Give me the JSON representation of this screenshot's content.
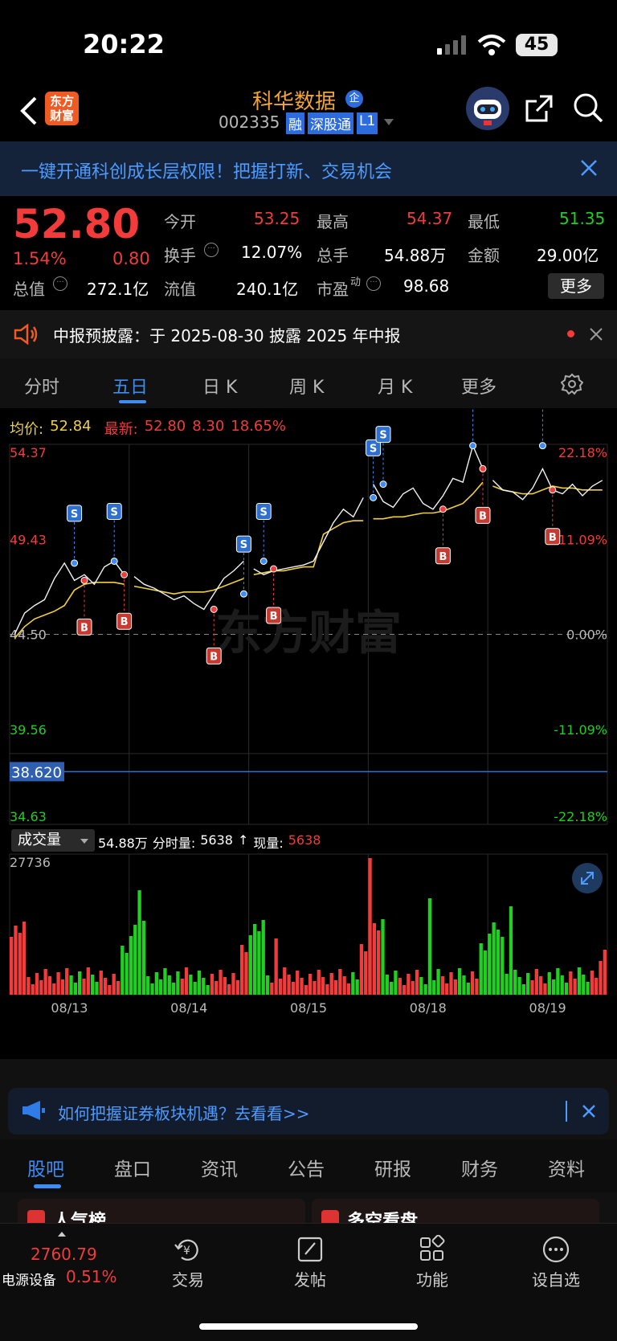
{
  "status_bar": {
    "time": "20:22",
    "battery": "45"
  },
  "nav": {
    "logo_line1": "东方",
    "logo_line2": "财富",
    "stock_name": "科华数据",
    "corp_badge": "企",
    "code": "002335",
    "tags": [
      "融",
      "深股通",
      "L1"
    ]
  },
  "banner": {
    "text": "一键开通科创成长层权限！把握打新、交易机会"
  },
  "quote": {
    "price": "52.80",
    "pct": "1.54%",
    "chg": "0.80",
    "open_label": "今开",
    "open": "53.25",
    "high_label": "最高",
    "high": "54.37",
    "low_label": "最低",
    "low": "51.35",
    "turnover_label": "换手",
    "turnover": "12.07%",
    "volume_label": "总手",
    "volume": "54.88万",
    "amount_label": "金额",
    "amount": "29.00亿",
    "mcap_label": "总值",
    "mcap": "272.1亿",
    "float_label": "流值",
    "float": "240.1亿",
    "pe_label": "市盈",
    "pe_sup": "动",
    "pe": "98.68",
    "more": "更多"
  },
  "notice": {
    "text": "中报预披露：于 2025-08-30 披露 2025 年中报"
  },
  "tabs": [
    "分时",
    "五日",
    "日 K",
    "周 K",
    "月 K",
    "更多"
  ],
  "active_tab": "五日",
  "chart_header": {
    "avg_label": "均价:",
    "avg": "52.84",
    "last_label": "最新:",
    "last": "52.80",
    "chg": "8.30",
    "pct": "18.65%"
  },
  "y_left": [
    "54.37",
    "49.43",
    "44.50",
    "39.56",
    "34.63"
  ],
  "y_right": [
    "22.18%",
    "11.09%",
    "0.00%",
    "-11.09%",
    "-22.18%"
  ],
  "crosshair_value": "38.620",
  "watermark": "东方财富",
  "volume_header": {
    "select": "成交量",
    "total": "54.88万",
    "fs_label": "分时量:",
    "fs": "5638",
    "arrow": "↑",
    "now_label": "现量:",
    "now": "5638",
    "max": "27736"
  },
  "chart_data": {
    "type": "line",
    "x_labels": [
      "08/13",
      "08/14",
      "08/15",
      "08/18",
      "08/19"
    ],
    "ylim": [
      34.63,
      54.37
    ],
    "prev_close": 44.5,
    "series": [
      {
        "values": [
          44.5,
          45.6,
          46.0,
          46.3,
          47.4,
          48.2,
          47.3,
          47.6,
          47.1,
          48.0,
          48.3,
          47.6,
          47.5,
          47.1,
          46.9,
          46.6,
          46.3,
          46.5,
          46.1,
          45.8,
          46.6,
          47.4,
          47.8,
          48.3,
          47.9,
          47.6,
          47.8,
          47.9,
          48.0,
          48.1,
          48.3,
          49.3,
          50.3,
          51.0,
          50.6,
          51.6,
          52.3,
          51.4,
          51.1,
          51.8,
          52.1,
          51.3,
          51.0,
          51.7,
          52.6,
          52.4,
          54.3,
          53.1,
          52.5,
          52.0,
          51.9,
          51.5,
          52.1,
          53.1,
          52.0,
          51.8,
          52.3,
          51.7,
          52.2,
          52.5
        ]
      },
      {
        "values": [
          44.3,
          44.9,
          45.3,
          45.5,
          45.7,
          46.0,
          46.8,
          47.1,
          47.2,
          47.2,
          47.2,
          47.1,
          47.0,
          46.9,
          46.8,
          46.7,
          46.6,
          46.7,
          46.7,
          46.7,
          46.8,
          47.0,
          47.2,
          47.4,
          47.6,
          47.7,
          47.8,
          47.8,
          47.9,
          48.0,
          48.0,
          49.7,
          50.0,
          50.3,
          50.4,
          50.4,
          50.5,
          50.5,
          50.6,
          50.6,
          50.7,
          50.8,
          50.8,
          50.9,
          51.1,
          51.3,
          51.8,
          52.4,
          52.2,
          52.0,
          51.9,
          51.8,
          51.8,
          52.0,
          52.2,
          52.1,
          52.1,
          52.0,
          52.0,
          52.0
        ]
      }
    ],
    "volume_max": 27736,
    "signals": [
      {
        "type": "S",
        "i": 6,
        "v": 48.2
      },
      {
        "type": "B",
        "i": 7,
        "v": 47.3
      },
      {
        "type": "S",
        "i": 10,
        "v": 48.3
      },
      {
        "type": "B",
        "i": 11,
        "v": 47.6
      },
      {
        "type": "B",
        "i": 20,
        "v": 45.8
      },
      {
        "type": "S",
        "i": 23,
        "v": 46.6
      },
      {
        "type": "S",
        "i": 25,
        "v": 48.3
      },
      {
        "type": "B",
        "i": 26,
        "v": 47.9
      },
      {
        "type": "S",
        "i": 36,
        "v": 51.6
      },
      {
        "type": "S",
        "i": 37,
        "v": 52.3
      },
      {
        "type": "B",
        "i": 43,
        "v": 51.0
      },
      {
        "type": "S",
        "i": 46,
        "v": 54.3
      },
      {
        "type": "B",
        "i": 47,
        "v": 53.1
      },
      {
        "type": "S",
        "i": 53,
        "v": 54.3
      },
      {
        "type": "B",
        "i": 54,
        "v": 52.0
      }
    ]
  },
  "ad": {
    "text": "如何把握证券板块机遇？去看看>>"
  },
  "subtabs": [
    "股吧",
    "盘口",
    "资讯",
    "公告",
    "研报",
    "财务",
    "资料"
  ],
  "active_subtab": "股吧",
  "cards": [
    "人气榜",
    "多空看盘"
  ],
  "bottom": {
    "index_value": "2760.79",
    "index_name": "电源设备",
    "index_pct": "0.51%",
    "items": [
      "交易",
      "发帖",
      "功能",
      "设自选"
    ]
  }
}
